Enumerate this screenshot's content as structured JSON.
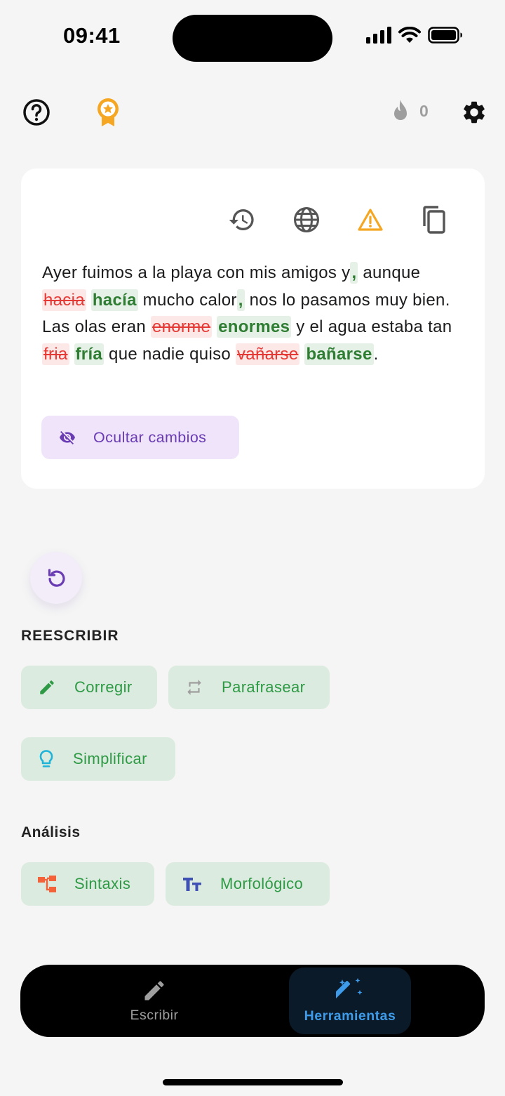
{
  "status_bar": {
    "time": "09:41"
  },
  "streak": {
    "count": "0"
  },
  "card": {
    "segments": [
      {
        "t": "Ayer fuimos a la playa con mis amigos y"
      },
      {
        "t": ",",
        "k": "ins"
      },
      {
        "t": " aunque "
      },
      {
        "t": "hacia",
        "k": "del"
      },
      {
        "t": " "
      },
      {
        "t": "hacía",
        "k": "ins"
      },
      {
        "t": " mucho calor"
      },
      {
        "t": ",",
        "k": "ins"
      },
      {
        "t": " nos lo pasamos muy bien. Las olas eran "
      },
      {
        "t": "enorme",
        "k": "del"
      },
      {
        "t": " "
      },
      {
        "t": "enormes",
        "k": "ins"
      },
      {
        "t": " y el agua estaba tan "
      },
      {
        "t": "fria",
        "k": "del"
      },
      {
        "t": " "
      },
      {
        "t": "fría",
        "k": "ins"
      },
      {
        "t": " que nadie quiso "
      },
      {
        "t": "vañarse",
        "k": "del"
      },
      {
        "t": " "
      },
      {
        "t": "bañarse",
        "k": "ins"
      },
      {
        "t": "."
      }
    ],
    "hide_changes_label": "Ocultar cambios"
  },
  "rewrite": {
    "title": "REESCRIBIR",
    "correct_label": "Corregir",
    "paraphrase_label": "Parafrasear",
    "simplify_label": "Simplificar"
  },
  "analysis": {
    "title": "Análisis",
    "syntax_label": "Sintaxis",
    "morph_label": "Morfológico"
  },
  "nav": {
    "write_label": "Escribir",
    "tools_label": "Herramientas"
  },
  "colors": {
    "accent_purple": "#6a3cb4",
    "insert_green": "#2e7d32",
    "delete_red": "#e53935",
    "warning_amber": "#f5a623",
    "tab_active_blue": "#3d9be9"
  }
}
